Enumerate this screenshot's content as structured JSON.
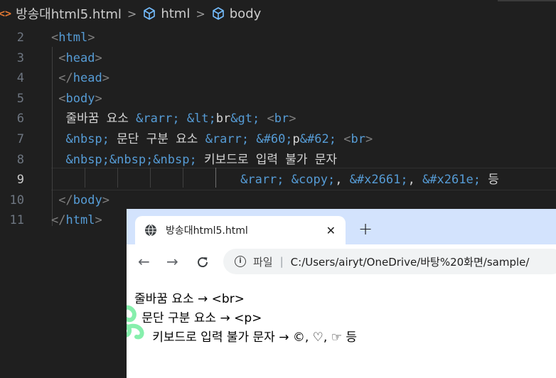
{
  "breadcrumb": {
    "html_icon": "<>",
    "file": "방송대html5.html",
    "sep": ">",
    "item1": "html",
    "item2": "body"
  },
  "editor": {
    "lines": [
      {
        "num": "2",
        "parts": [
          [
            "punc",
            "<"
          ],
          [
            "tag",
            "html"
          ],
          [
            "punc",
            ">"
          ]
        ]
      },
      {
        "num": "3",
        "parts": [
          [
            "txt",
            " "
          ],
          [
            "punc",
            "<"
          ],
          [
            "tag",
            "head"
          ],
          [
            "punc",
            ">"
          ]
        ]
      },
      {
        "num": "4",
        "parts": [
          [
            "txt",
            " "
          ],
          [
            "punc",
            "</"
          ],
          [
            "tag",
            "head"
          ],
          [
            "punc",
            ">"
          ]
        ]
      },
      {
        "num": "5",
        "parts": [
          [
            "txt",
            " "
          ],
          [
            "punc",
            "<"
          ],
          [
            "tag",
            "body"
          ],
          [
            "punc",
            ">"
          ]
        ]
      },
      {
        "num": "6",
        "parts": [
          [
            "txt",
            "  줄바꿈 요소 "
          ],
          [
            "ent",
            "&rarr;"
          ],
          [
            "txt",
            " "
          ],
          [
            "ent",
            "&lt;"
          ],
          [
            "txt",
            "br"
          ],
          [
            "ent",
            "&gt;"
          ],
          [
            "txt",
            " "
          ],
          [
            "punc",
            "<"
          ],
          [
            "tag",
            "br"
          ],
          [
            "punc",
            ">"
          ]
        ]
      },
      {
        "num": "7",
        "parts": [
          [
            "txt",
            "  "
          ],
          [
            "ent",
            "&nbsp;"
          ],
          [
            "txt",
            " 문단 구분 요소 "
          ],
          [
            "ent",
            "&rarr;"
          ],
          [
            "txt",
            " "
          ],
          [
            "ent",
            "&#60;"
          ],
          [
            "txt",
            "p"
          ],
          [
            "ent",
            "&#62;"
          ],
          [
            "txt",
            " "
          ],
          [
            "punc",
            "<"
          ],
          [
            "tag",
            "br"
          ],
          [
            "punc",
            ">"
          ]
        ]
      },
      {
        "num": "8",
        "parts": [
          [
            "txt",
            "  "
          ],
          [
            "ent",
            "&nbsp;&nbsp;&nbsp;"
          ],
          [
            "txt",
            " 키보드로 입력 불가 문자"
          ]
        ]
      },
      {
        "num": "9",
        "active": true,
        "parts": [
          [
            "txt",
            "                          "
          ],
          [
            "ent",
            "&rarr;"
          ],
          [
            "txt",
            " "
          ],
          [
            "ent",
            "&copy;"
          ],
          [
            "txt",
            ", "
          ],
          [
            "ent",
            "&#x2661;"
          ],
          [
            "txt",
            ", "
          ],
          [
            "ent",
            "&#x261e;"
          ],
          [
            "txt",
            " 등"
          ]
        ]
      },
      {
        "num": "10",
        "parts": [
          [
            "txt",
            " "
          ],
          [
            "punc",
            "</"
          ],
          [
            "tag",
            "body"
          ],
          [
            "punc",
            ">"
          ]
        ]
      },
      {
        "num": "11",
        "parts": [
          [
            "punc",
            "</"
          ],
          [
            "tag",
            "html"
          ],
          [
            "punc",
            ">"
          ]
        ]
      }
    ]
  },
  "browser": {
    "tab_title": "방송대html5.html",
    "tab_close": "✕",
    "new_tab": "+",
    "back": "←",
    "forward": "→",
    "omni_label": "파일",
    "omni_sep": "|",
    "url": "C:/Users/airyt/OneDrive/바탕%20화면/sample/",
    "page_lines": [
      "줄바꿈 요소 → <br>",
      " 문단 구분 요소 → <p>",
      "   키보드로 입력 불가 문자 → ©, ♡, ☞ 등"
    ]
  },
  "colors": {
    "editor_bg": "#1f1f1f",
    "tag": "#569cd6",
    "text": "#d4d4d4",
    "tabbar_bg": "#d3e3fd"
  }
}
